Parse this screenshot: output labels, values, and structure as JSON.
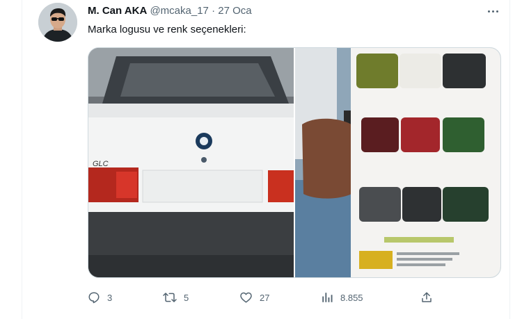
{
  "tweet": {
    "author_name": "M. Can AKA",
    "author_handle": "@mcaka_17",
    "separator": "·",
    "date": "27 Oca",
    "text": "Marka logusu ve renk seçenekleri:",
    "media": [
      {
        "icon": "car-rear-photo"
      },
      {
        "icon": "brochure-photo"
      }
    ],
    "actions": {
      "replies": "3",
      "retweets": "5",
      "likes": "27",
      "views": "8.855"
    }
  },
  "colors": {
    "text_primary": "#0f1419",
    "text_secondary": "#536471",
    "border": "#cfd9de"
  }
}
